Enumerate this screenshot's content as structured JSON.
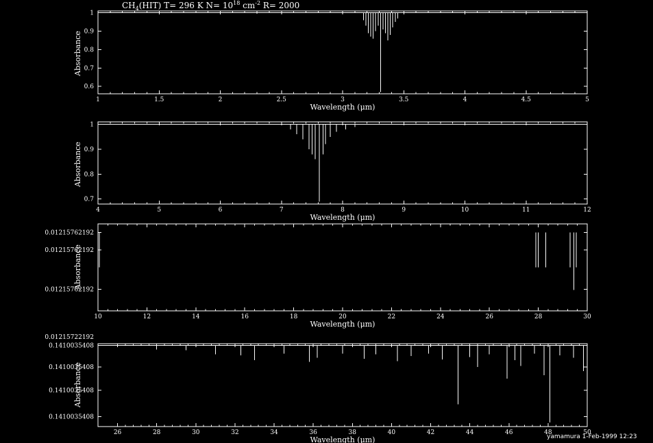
{
  "header": {
    "title_main": "CH",
    "title_sub": "4",
    "title_mid": "(HIT)  T= 296 K  N= 10",
    "title_sup": "18",
    "title_unit": " cm",
    "title_unit_sup": "-2",
    "title_end": "  R= 2000"
  },
  "footer": {
    "text": "yamamura  1-Feb-1999 12:23"
  },
  "chart_data": [
    {
      "type": "line",
      "xlabel": "Wavelength (μm)",
      "ylabel": "Absorbance",
      "xlim": [
        1,
        5
      ],
      "ylim": [
        0.56,
        1.01
      ],
      "xticks": [
        1,
        1.5,
        2,
        2.5,
        3,
        3.5,
        4,
        4.5,
        5
      ],
      "xticklabels": [
        "1",
        "1.5",
        "2",
        "2.5",
        "3",
        "3.5",
        "4",
        "4.5",
        "5"
      ],
      "yticks": [
        0.6,
        0.7,
        0.8,
        0.9,
        1
      ],
      "yticklabels": [
        "0.6",
        "0.7",
        "0.8",
        "0.9",
        "1"
      ],
      "baseline": 1,
      "lines": [
        [
          2.3,
          0.995
        ],
        [
          3.17,
          0.96
        ],
        [
          3.19,
          0.93
        ],
        [
          3.21,
          0.89
        ],
        [
          3.23,
          0.87
        ],
        [
          3.25,
          0.86
        ],
        [
          3.27,
          0.9
        ],
        [
          3.29,
          0.93
        ],
        [
          3.31,
          0.57
        ],
        [
          3.33,
          0.91
        ],
        [
          3.35,
          0.89
        ],
        [
          3.37,
          0.85
        ],
        [
          3.39,
          0.88
        ],
        [
          3.41,
          0.92
        ],
        [
          3.43,
          0.95
        ],
        [
          3.45,
          0.97
        ]
      ]
    },
    {
      "type": "line",
      "xlabel": "Wavelength (μm)",
      "ylabel": "Absorbance",
      "xlim": [
        4,
        12
      ],
      "ylim": [
        0.68,
        1.01
      ],
      "xticks": [
        4,
        5,
        6,
        7,
        8,
        9,
        10,
        11,
        12
      ],
      "xticklabels": [
        "4",
        "5",
        "6",
        "7",
        "8",
        "9",
        "10",
        "11",
        "12"
      ],
      "yticks": [
        0.7,
        0.8,
        0.9,
        1
      ],
      "yticklabels": [
        "0.7",
        "0.8",
        "0.9",
        "1"
      ],
      "baseline": 1,
      "lines": [
        [
          7.15,
          0.98
        ],
        [
          7.25,
          0.96
        ],
        [
          7.35,
          0.94
        ],
        [
          7.45,
          0.9
        ],
        [
          7.5,
          0.88
        ],
        [
          7.55,
          0.86
        ],
        [
          7.62,
          0.69
        ],
        [
          7.68,
          0.88
        ],
        [
          7.72,
          0.92
        ],
        [
          7.8,
          0.95
        ],
        [
          7.9,
          0.97
        ],
        [
          8.05,
          0.98
        ],
        [
          8.2,
          0.99
        ]
      ]
    },
    {
      "type": "line",
      "xlabel": "Wavelength (μm)",
      "ylabel": "Absorbance",
      "xlim": [
        10,
        30
      ],
      "ylim": [
        0,
        1
      ],
      "xticks": [
        10,
        12,
        14,
        16,
        18,
        20,
        22,
        24,
        26,
        28,
        30
      ],
      "xticklabels": [
        "10",
        "12",
        "14",
        "16",
        "18",
        "20",
        "22",
        "24",
        "26",
        "28",
        "30"
      ],
      "yticks": [
        0.9,
        0.7,
        0.25,
        -0.3
      ],
      "yticklabels": [
        "0.01215762192",
        "0.01215762192",
        "0.01215762192",
        "0.01215722192"
      ],
      "bars": [
        [
          10.05,
          0.9,
          0.5
        ],
        [
          27.9,
          0.9,
          0.5
        ],
        [
          28.0,
          0.9,
          0.5
        ],
        [
          28.3,
          0.9,
          0.5
        ],
        [
          29.3,
          0.9,
          0.5
        ],
        [
          29.45,
          0.9,
          0.24
        ],
        [
          29.55,
          0.9,
          0.5
        ]
      ]
    },
    {
      "type": "line",
      "xlabel": "Wavelength (μm)",
      "ylabel": "Absorbance",
      "xlim": [
        25,
        50
      ],
      "ylim": [
        0,
        1
      ],
      "xticks": [
        26,
        28,
        30,
        32,
        34,
        36,
        38,
        40,
        42,
        44,
        46,
        48,
        50
      ],
      "xticklabels": [
        "26",
        "28",
        "30",
        "32",
        "34",
        "36",
        "38",
        "40",
        "42",
        "44",
        "46",
        "48",
        "50"
      ],
      "yticks": [
        0.98,
        0.72,
        0.44,
        0.12
      ],
      "yticklabels": [
        "0.1410035408",
        "0.1410035408",
        "0.1410035408",
        "0.1410035408"
      ],
      "baseline": 0.98,
      "lines": [
        [
          28.0,
          0.93
        ],
        [
          29.5,
          0.92
        ],
        [
          31.0,
          0.87
        ],
        [
          32.3,
          0.86
        ],
        [
          33.0,
          0.8
        ],
        [
          34.5,
          0.88
        ],
        [
          35.8,
          0.78
        ],
        [
          36.2,
          0.83
        ],
        [
          37.5,
          0.88
        ],
        [
          38.6,
          0.82
        ],
        [
          39.2,
          0.87
        ],
        [
          40.3,
          0.79
        ],
        [
          41.0,
          0.85
        ],
        [
          41.9,
          0.88
        ],
        [
          42.6,
          0.81
        ],
        [
          43.4,
          0.27
        ],
        [
          44.0,
          0.84
        ],
        [
          44.4,
          0.72
        ],
        [
          45.0,
          0.87
        ],
        [
          45.9,
          0.58
        ],
        [
          46.3,
          0.8
        ],
        [
          46.6,
          0.73
        ],
        [
          47.3,
          0.88
        ],
        [
          47.8,
          0.62
        ],
        [
          48.1,
          0.05
        ],
        [
          48.6,
          0.86
        ],
        [
          49.3,
          0.83
        ],
        [
          49.8,
          0.67
        ]
      ]
    }
  ]
}
